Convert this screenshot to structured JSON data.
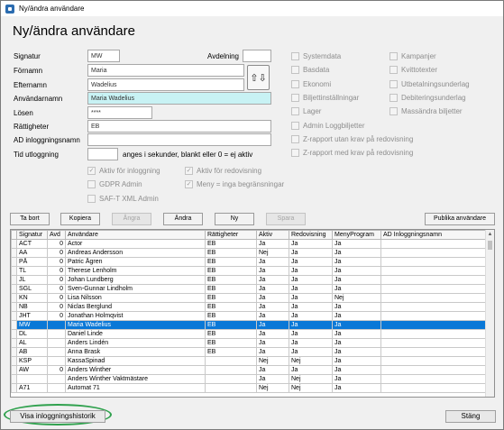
{
  "window": {
    "title": "Ny/ändra användare"
  },
  "heading": "Ny/ändra användare",
  "form": {
    "signatur_label": "Signatur",
    "signatur_value": "MW",
    "avdelning_label": "Avdelning",
    "avdelning_value": "",
    "fornamn_label": "Förnamn",
    "fornamn_value": "Maria",
    "efternamn_label": "Efternamn",
    "efternamn_value": "Wadelius",
    "anvandarnamn_label": "Användarnamn",
    "anvandarnamn_value": "Maria Wadelius",
    "losen_label": "Lösen",
    "losen_value": "****",
    "rattigheter_label": "Rättigheter",
    "rattigheter_value": "EB",
    "ad_label": "AD inloggningsnamn",
    "ad_value": "",
    "tid_label": "Tid utloggning",
    "tid_value": "",
    "tid_hint": "anges i sekunder, blankt eller 0 = ej aktiv",
    "swap_icon_text": "⇧⇩"
  },
  "checks_mid": [
    {
      "label": "Aktiv för inloggning",
      "checked": true
    },
    {
      "label": "Aktiv för redovisning",
      "checked": true
    },
    {
      "label": "GDPR Admin",
      "checked": false
    },
    {
      "label": "Meny = inga begränsningar",
      "checked": true
    },
    {
      "label": "SAF-T XML Admin",
      "checked": false
    }
  ],
  "checks_right_a": [
    {
      "label": "Systemdata",
      "checked": false
    },
    {
      "label": "Basdata",
      "checked": false
    },
    {
      "label": "Ekonomi",
      "checked": false
    },
    {
      "label": "Biljettinställningar",
      "checked": false
    },
    {
      "label": "Lager",
      "checked": false
    },
    {
      "label": "Admin Loggbiljetter",
      "checked": false
    },
    {
      "label": "Z-rapport utan krav på redovisning",
      "checked": false
    },
    {
      "label": "Z-rapport med krav på redovisning",
      "checked": false
    }
  ],
  "checks_right_b": [
    {
      "label": "Kampanjer",
      "checked": false
    },
    {
      "label": "Kvittotexter",
      "checked": false
    },
    {
      "label": "Utbetalningsunderlag",
      "checked": false
    },
    {
      "label": "Debiteringsunderlag",
      "checked": false
    },
    {
      "label": "Massändra biljetter",
      "checked": false
    }
  ],
  "toolbar": {
    "ta_bort": "Ta bort",
    "kopiera": "Kopiera",
    "angra": "Ångra",
    "andra": "Ändra",
    "ny": "Ny",
    "spara": "Spara",
    "publika": "Publika användare"
  },
  "grid": {
    "columns": [
      "Signatur",
      "Avd",
      "Användare",
      "Rättigheter",
      "Aktiv",
      "Redovisning",
      "MenyProgram",
      "AD Inloggningsnamn"
    ],
    "rows": [
      [
        "ACT",
        "0",
        "Actor",
        "EB",
        "Ja",
        "Ja",
        "Ja",
        ""
      ],
      [
        "AA",
        "0",
        "Andreas Andersson",
        "EB",
        "Nej",
        "Ja",
        "Ja",
        ""
      ],
      [
        "PÅ",
        "0",
        "Patric Ågren",
        "EB",
        "Ja",
        "Ja",
        "Ja",
        ""
      ],
      [
        "TL",
        "0",
        "Therese Lenholm",
        "EB",
        "Ja",
        "Ja",
        "Ja",
        ""
      ],
      [
        "JL",
        "0",
        "Johan Lundberg",
        "EB",
        "Ja",
        "Ja",
        "Ja",
        ""
      ],
      [
        "SGL",
        "0",
        "Sven-Gunnar Lindholm",
        "EB",
        "Ja",
        "Ja",
        "Ja",
        ""
      ],
      [
        "KN",
        "0",
        "Lisa Nilsson",
        "EB",
        "Ja",
        "Ja",
        "Nej",
        ""
      ],
      [
        "NB",
        "0",
        "Niclas Berglund",
        "EB",
        "Ja",
        "Ja",
        "Ja",
        ""
      ],
      [
        "JHT",
        "0",
        "Jonathan Holmqvist",
        "EB",
        "Ja",
        "Ja",
        "Ja",
        ""
      ],
      [
        "MW",
        "",
        "Maria Wadelius",
        "EB",
        "Ja",
        "Ja",
        "Ja",
        ""
      ],
      [
        "DL",
        "",
        "Daniel Linde",
        "EB",
        "Ja",
        "Ja",
        "Ja",
        ""
      ],
      [
        "AL",
        "",
        "Anders Lindén",
        "EB",
        "Ja",
        "Ja",
        "Ja",
        ""
      ],
      [
        "AB",
        "",
        "Anna Brask",
        "EB",
        "Ja",
        "Ja",
        "Ja",
        ""
      ],
      [
        "KSP",
        "",
        "KassaSpinad",
        "",
        "Nej",
        "Nej",
        "Ja",
        ""
      ],
      [
        "AW",
        "0",
        "Anders Winther",
        "",
        "Ja",
        "Ja",
        "Ja",
        ""
      ],
      [
        "",
        "",
        "Anders Winther Vaktmästare",
        "",
        "Ja",
        "Nej",
        "Ja",
        ""
      ],
      [
        "A71",
        "",
        "Automat 71",
        "",
        "Nej",
        "Nej",
        "Ja",
        ""
      ]
    ],
    "selected_row": 9
  },
  "footer": {
    "historik": "Visa inloggningshistorik",
    "stang": "Stäng"
  },
  "colors": {
    "selection": "#0a78d7",
    "highlight_input": "#c8f2f4",
    "annotation": "#30a14e"
  }
}
